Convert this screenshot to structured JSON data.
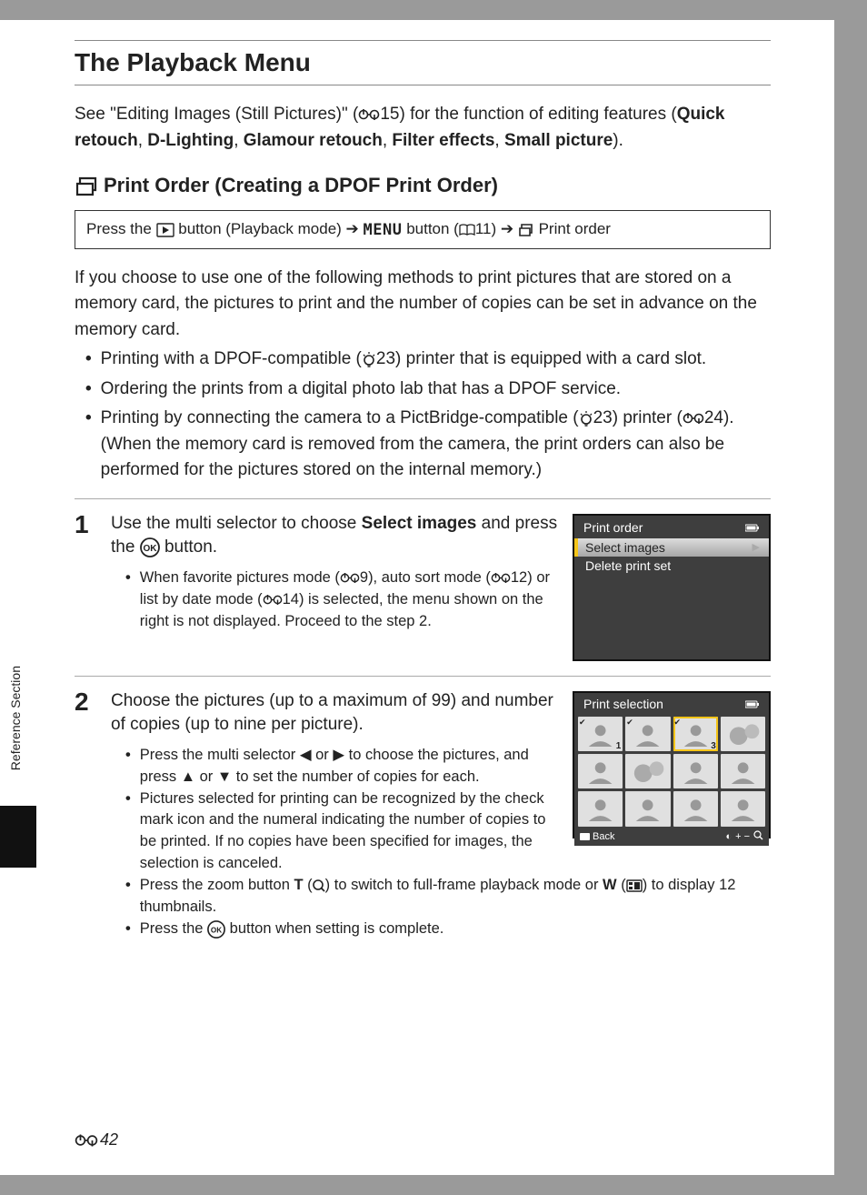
{
  "header": {
    "title": "The Playback Menu"
  },
  "intro": {
    "line1a": "See \"Editing Images (Still Pictures)\" (",
    "ref1": "15",
    "line1b": ") for the function of editing features ",
    "line2a": "(",
    "b1": "Quick retouch",
    "b2": "D-Lighting",
    "b3": "Glamour retouch",
    "b4": "Filter effects",
    "b5": "Small picture",
    "line2b": ")."
  },
  "h2": {
    "text": "Print Order (Creating a DPOF Print Order)"
  },
  "path": {
    "a": "Press the ",
    "b": " button (Playback mode) ",
    "c": " button (",
    "d": "11) ",
    "e": " Print order"
  },
  "body1": {
    "p": "If you choose to use one of the following methods to print pictures that are stored on a memory card, the pictures to print and the number of copies can be set in advance on the memory card."
  },
  "bullets": {
    "b1a": "Printing with a DPOF-compatible (",
    "b1ref": "23",
    "b1b": ") printer that is equipped with a card slot.",
    "b2": "Ordering the prints from a digital photo lab that has a DPOF service.",
    "b3a": "Printing by connecting the camera to a PictBridge-compatible (",
    "b3ref1": "23",
    "b3b": ") printer (",
    "b3ref2": "24",
    "b3c": "). (When the memory card is removed from the camera, the print orders can also be performed for the pictures stored on the internal memory.)"
  },
  "step1": {
    "num": "1",
    "headA": "Use the multi selector to choose ",
    "headBold": "Select images",
    "headB": " and press the ",
    "headC": " button.",
    "sub1a": "When favorite pictures mode (",
    "sub1ref1": "9",
    "sub1b": "), auto sort mode (",
    "sub1ref2": "12",
    "sub1c": ") or list by date mode (",
    "sub1ref3": "14",
    "sub1d": ") is selected, the menu shown on the right is not displayed. Proceed to the step 2.",
    "screen": {
      "title": "Print order",
      "row1": "Select images",
      "row2": "Delete print set"
    }
  },
  "step2": {
    "num": "2",
    "head": "Choose the pictures (up to a maximum of 99) and number of copies (up to nine per picture).",
    "sub1": "Press the multi selector ◀ or ▶ to choose the pictures, and press ▲ or ▼ to set the number of copies for each.",
    "sub2": "Pictures selected for printing can be recognized by the check mark icon and the numeral indicating the number of copies to be printed. If no copies have been specified for images, the selection is canceled.",
    "sub3a": "Press the zoom button ",
    "sub3T": "T",
    "sub3b": " (",
    "sub3c": ") to switch to full-frame playback mode or ",
    "sub3W": "W",
    "sub3d": " (",
    "sub3e": ") to display 12 thumbnails.",
    "sub4a": "Press the ",
    "sub4b": " button when setting is complete.",
    "screen": {
      "title": "Print selection",
      "back": "Back",
      "thumb_marks": {
        "n1": "1",
        "n3": "3"
      }
    }
  },
  "sidebar": {
    "label": "Reference Section"
  },
  "footer": {
    "pagenum": "42"
  },
  "glyph": {
    "arrow": "➔",
    "menu": "MENU"
  }
}
